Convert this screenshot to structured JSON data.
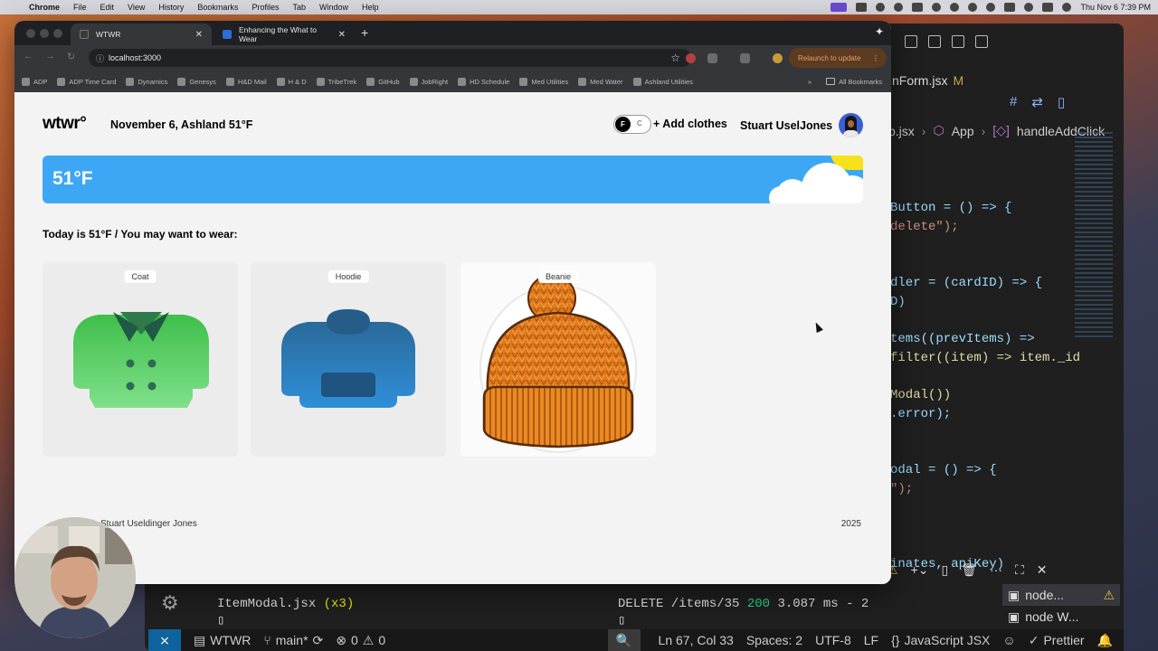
{
  "menubar": {
    "app": "Chrome",
    "items": [
      "File",
      "Edit",
      "View",
      "History",
      "Bookmarks",
      "Profiles",
      "Tab",
      "Window",
      "Help"
    ],
    "clock": "Thu Nov 6  7:39 PM"
  },
  "browser": {
    "tabs": [
      {
        "title": "WTWR",
        "active": true
      },
      {
        "title": "Enhancing the What to Wear",
        "active": false
      }
    ],
    "url": "localhost:3000",
    "relaunch_label": "Relaunch to update",
    "bookmarks": [
      "ADP",
      "ADP Time Card",
      "Dynamics",
      "Genesys",
      "H&D Mail",
      "H & D",
      "TribeTrek",
      "GitHub",
      "JobRight",
      "HD Schedule",
      "Med Utilities",
      "Med Water",
      "Ashland Utilities"
    ],
    "more_bookmarks": "»",
    "all_bookmarks": "All Bookmarks"
  },
  "app": {
    "logo": "wtwr°",
    "date_location": "November 6, Ashland 51°F",
    "toggle": {
      "active": "F",
      "inactive": "C"
    },
    "add_clothes": "+ Add clothes",
    "username": "Stuart UselJones",
    "weather": {
      "temperature": "51°F",
      "condition": "day-cloudy"
    },
    "suggestion": "Today is 51°F / You may want to wear:",
    "items": [
      {
        "name": "Coat",
        "icon": "coat-icon"
      },
      {
        "name": "Hoodie",
        "icon": "hoodie-icon"
      },
      {
        "name": "Beanie",
        "icon": "beanie-icon"
      }
    ],
    "footer": {
      "author": "Stuart Useldinger Jones",
      "year": "2025"
    }
  },
  "vscode": {
    "tab_file": "nForm.jsx",
    "tab_modified": "M",
    "breadcrumb": {
      "file": "p.jsx",
      "symbol1": "App",
      "symbol2": "handleAddClick"
    },
    "code_lines": [
      "Button = () => {",
      "delete\");",
      "dler = (cardID) => {",
      "D)",
      "tems((prevItems) =>",
      "filter((item) => item._id",
      "Modal())",
      ".error);",
      "odal = () => {",
      "\");",
      "inates, apiKey)"
    ],
    "terminal_left": {
      "file": "ItemModal.jsx",
      "count": "(x3)"
    },
    "terminal_right": {
      "method": "DELETE /items/35",
      "status": "200",
      "timing": "3.087 ms - 2"
    },
    "terminals": [
      "node...",
      "node W..."
    ],
    "status": {
      "folder": "WTWR",
      "branch": "main*",
      "errors": "0",
      "warnings": "0",
      "position": "Ln 67, Col 33",
      "spaces": "Spaces: 2",
      "encoding": "UTF-8",
      "eol": "LF",
      "language": "JavaScript JSX",
      "formatter": "Prettier"
    }
  }
}
